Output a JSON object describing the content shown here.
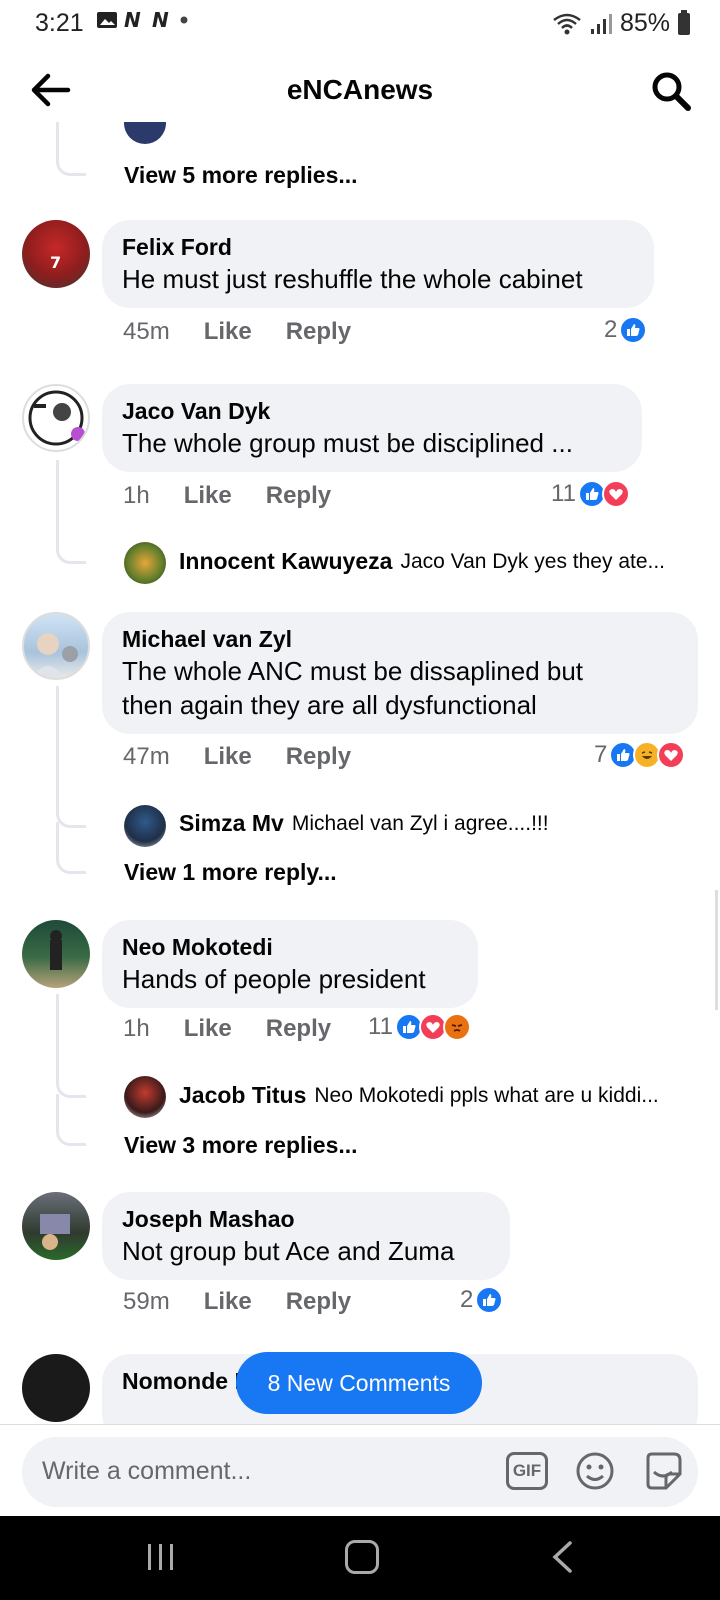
{
  "status_bar": {
    "time": "3:21",
    "battery": "85%"
  },
  "header": {
    "title": "eNCAnews"
  },
  "comments": [
    {
      "author": "Felix Ford",
      "text": "He must just reshuffle the whole cabinet",
      "time": "45m",
      "like_label": "Like",
      "reply_label": "Reply",
      "reaction_count": "2",
      "reactions": [
        "like"
      ]
    },
    {
      "author": "Jaco Van Dyk",
      "text": "The whole group must be disciplined ...",
      "time": "1h",
      "like_label": "Like",
      "reply_label": "Reply",
      "reaction_count": "11",
      "reactions": [
        "like",
        "love"
      ],
      "reply_preview": {
        "author": "Innocent Kawuyeza",
        "text": "Jaco Van Dyk yes they ate..."
      }
    },
    {
      "author": "Michael van Zyl",
      "text_line1": "The whole ANC must be dissaplined but",
      "text_line2": "then again they are all dysfunctional",
      "time": "47m",
      "like_label": "Like",
      "reply_label": "Reply",
      "reaction_count": "7",
      "reactions": [
        "like",
        "haha",
        "love"
      ],
      "reply_preview": {
        "author": "Simza Mv",
        "text": "Michael van Zyl i agree....!!!"
      },
      "more_replies": "View 1 more reply..."
    },
    {
      "author": "Neo Mokotedi",
      "text": "Hands of people president",
      "time": "1h",
      "like_label": "Like",
      "reply_label": "Reply",
      "reaction_count": "11",
      "reactions": [
        "like",
        "love",
        "angry"
      ],
      "reply_preview": {
        "author": "Jacob Titus",
        "text": "Neo Mokotedi ppls what are u kiddi..."
      },
      "more_replies": "View 3 more replies..."
    },
    {
      "author": "Joseph Mashao",
      "text": "Not group but Ace and Zuma",
      "time": "59m",
      "like_label": "Like",
      "reply_label": "Reply",
      "reaction_count": "2",
      "reactions": [
        "like"
      ]
    },
    {
      "author": "Nomonde N"
    }
  ],
  "top_thread": {
    "more_replies": "View 5 more replies..."
  },
  "new_comments_label": "8 New Comments",
  "composer": {
    "placeholder": "Write a comment...",
    "gif_label": "GIF"
  },
  "colors": {
    "accent": "#1877f2",
    "bubble": "#f0f2f5",
    "muted": "#65676b"
  }
}
